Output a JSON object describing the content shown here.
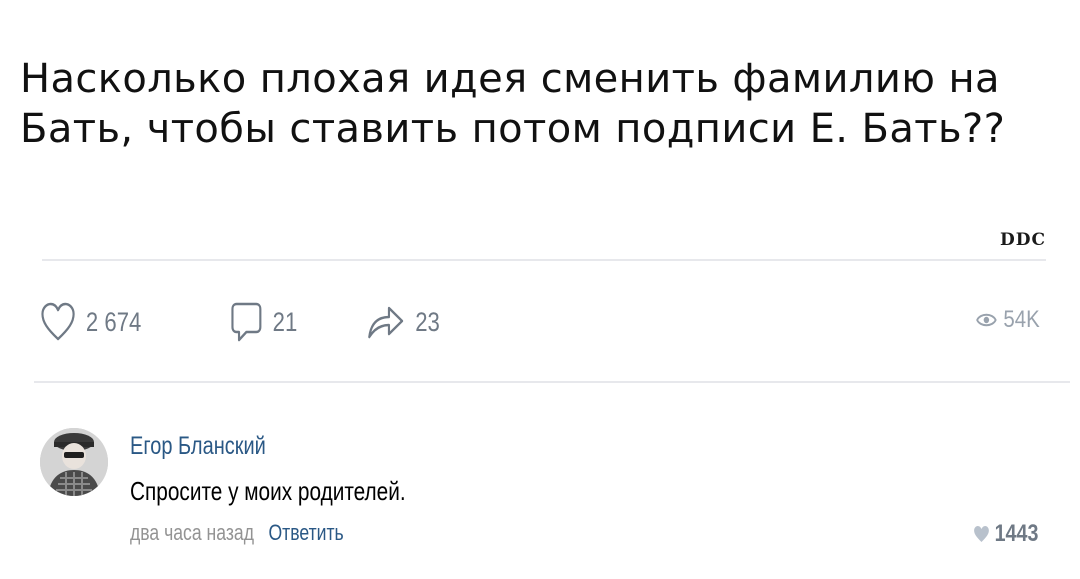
{
  "post": {
    "text": "Насколько плохая идея сменить фамилию на Бать, чтобы ставить потом подписи Е. Бать??",
    "watermark": "DDC"
  },
  "actions": {
    "likes": "2 674",
    "comments": "21",
    "shares": "23",
    "views": "54K"
  },
  "comment": {
    "author": "Егор Бланский",
    "text": "Спросите у моих родителей.",
    "time": "два часа назад",
    "reply_label": "Ответить",
    "likes": "1443"
  },
  "colors": {
    "link": "#2a5885",
    "icon": "#6f7985",
    "muted": "#939393",
    "divider": "#e7e8ec"
  },
  "icons": [
    "heart-icon",
    "comment-icon",
    "share-icon",
    "eye-icon",
    "heart-filled-icon"
  ]
}
